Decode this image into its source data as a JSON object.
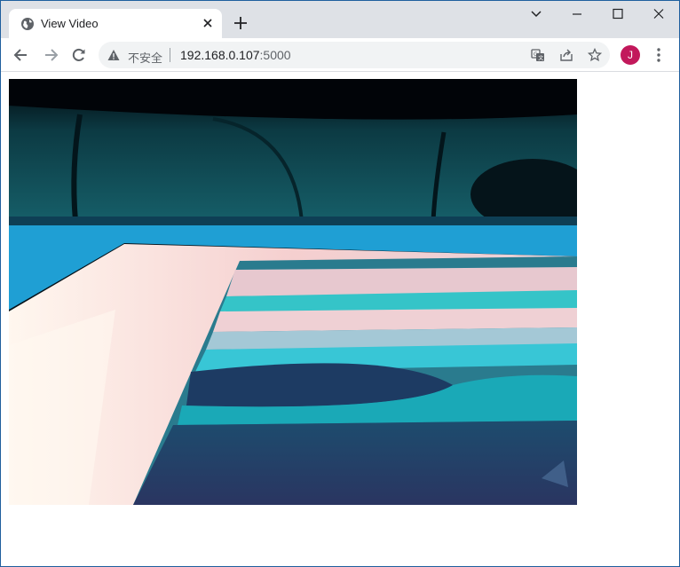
{
  "browser": {
    "tab": {
      "title": "View Video",
      "favicon": "globe-icon"
    },
    "new_tab_icon": "plus-icon",
    "window_controls": [
      "tab-search-icon",
      "minimize-icon",
      "maximize-icon",
      "close-icon"
    ],
    "toolbar": {
      "back_icon": "back-arrow-icon",
      "forward_icon": "forward-arrow-icon",
      "reload_icon": "reload-icon",
      "security_label": "不安全",
      "url_host": "192.168.0.107",
      "url_port": ":5000",
      "omnibox_icons": [
        "translate-icon",
        "share-icon",
        "bookmark-star-icon"
      ],
      "avatar_letter": "J",
      "menu_icon": "kebab-menu-icon"
    }
  },
  "page": {
    "video_stream": "camera-frame"
  },
  "colors": {
    "tabstrip": "#dee1e6",
    "omnibox": "#f1f3f4",
    "avatar": "#c2185b",
    "window_border": "#1f5f9e"
  }
}
